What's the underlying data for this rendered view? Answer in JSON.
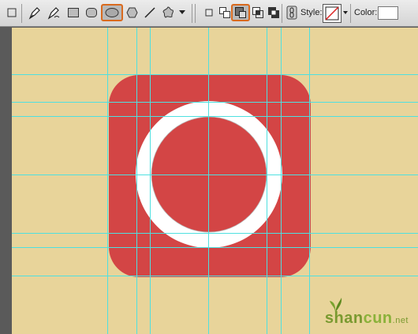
{
  "toolbar": {
    "style_label": "Style:",
    "color_label": "Color:",
    "tools": [
      {
        "name": "rectangle-marquee-icon"
      },
      {
        "name": "pen-tool-icon"
      },
      {
        "name": "freeform-pen-tool-icon"
      },
      {
        "name": "rectangle-shape-icon"
      },
      {
        "name": "rounded-rectangle-shape-icon"
      },
      {
        "name": "ellipse-shape-icon",
        "selected": true
      },
      {
        "name": "polygon-shape-icon"
      },
      {
        "name": "line-shape-icon"
      },
      {
        "name": "custom-shape-icon"
      }
    ],
    "path_ops": [
      {
        "name": "new-shape-layer-icon"
      },
      {
        "name": "add-to-shape-area-icon"
      },
      {
        "name": "subtract-from-shape-area-icon",
        "selected": true
      },
      {
        "name": "intersect-shape-areas-icon"
      },
      {
        "name": "exclude-overlapping-areas-icon"
      }
    ]
  },
  "colors": {
    "canvas": "#e8d49a",
    "icon_red": "#d34545",
    "ring": "#ffffff",
    "guides": "#4fe0e0",
    "selection_highlight": "#d96a1e"
  },
  "watermark": {
    "main_a": "shan",
    "main_b": "cun",
    "suffix": ".net"
  }
}
